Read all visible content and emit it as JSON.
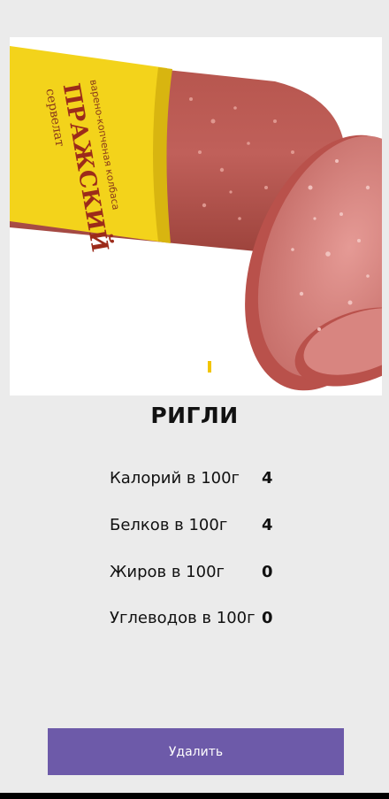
{
  "product": {
    "image": {
      "subject": "sausage-photo",
      "package_brand": "ПРАЖСКИЙ",
      "package_type": "сервелат",
      "package_desc": "варено-копченая колбаса",
      "carousel_indicator": "1"
    },
    "name": "РИГЛИ"
  },
  "nutrition": [
    {
      "label": "Калорий в 100г",
      "value": "4"
    },
    {
      "label": "Белков в 100г",
      "value": "4"
    },
    {
      "label": "Жиров в 100г",
      "value": "0"
    },
    {
      "label": "Углеводов в 100г",
      "value": "0"
    }
  ],
  "actions": {
    "delete_label": "Удалить"
  },
  "colors": {
    "button": "#6d5aa9",
    "background": "#ebebeb",
    "indicator": "#f2c500"
  }
}
